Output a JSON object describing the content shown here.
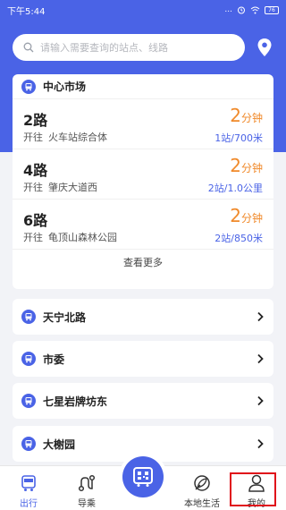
{
  "status": {
    "time": "下午5:44",
    "dots": "...",
    "battery": "76"
  },
  "search": {
    "placeholder": "请输入需要查询的站点、线路"
  },
  "icons": {
    "search": "search-icon",
    "location": "location-pin-icon",
    "bus": "bus-stop-icon",
    "chevron": "chevron-right-icon",
    "scan": "bus-qr-icon"
  },
  "nearby": {
    "station": "中心市场",
    "go_prefix": "开往",
    "routes": [
      {
        "name": "2路",
        "dest": "火车站综合体",
        "eta": "2",
        "eta_unit": "分钟",
        "distance": "1站/700米"
      },
      {
        "name": "4路",
        "dest": "肇庆大道西",
        "eta": "2",
        "eta_unit": "分钟",
        "distance": "2站/1.0公里"
      },
      {
        "name": "6路",
        "dest": "龟顶山森林公园",
        "eta": "2",
        "eta_unit": "分钟",
        "distance": "2站/850米"
      }
    ],
    "more_label": "查看更多"
  },
  "stations": [
    "天宁北路",
    "市委",
    "七星岩牌坊东",
    "大榭园"
  ],
  "tabs": [
    {
      "label": "出行",
      "icon": "bus-tab-icon",
      "active": true
    },
    {
      "label": "导乘",
      "icon": "route-guide-icon",
      "active": false
    },
    {
      "label": "本地生活",
      "icon": "leaf-icon",
      "active": false
    },
    {
      "label": "我的",
      "icon": "user-icon",
      "active": false
    }
  ],
  "colors": {
    "primary": "#4a63e6",
    "eta": "#f08a2b",
    "highlight": "#e0101a"
  }
}
